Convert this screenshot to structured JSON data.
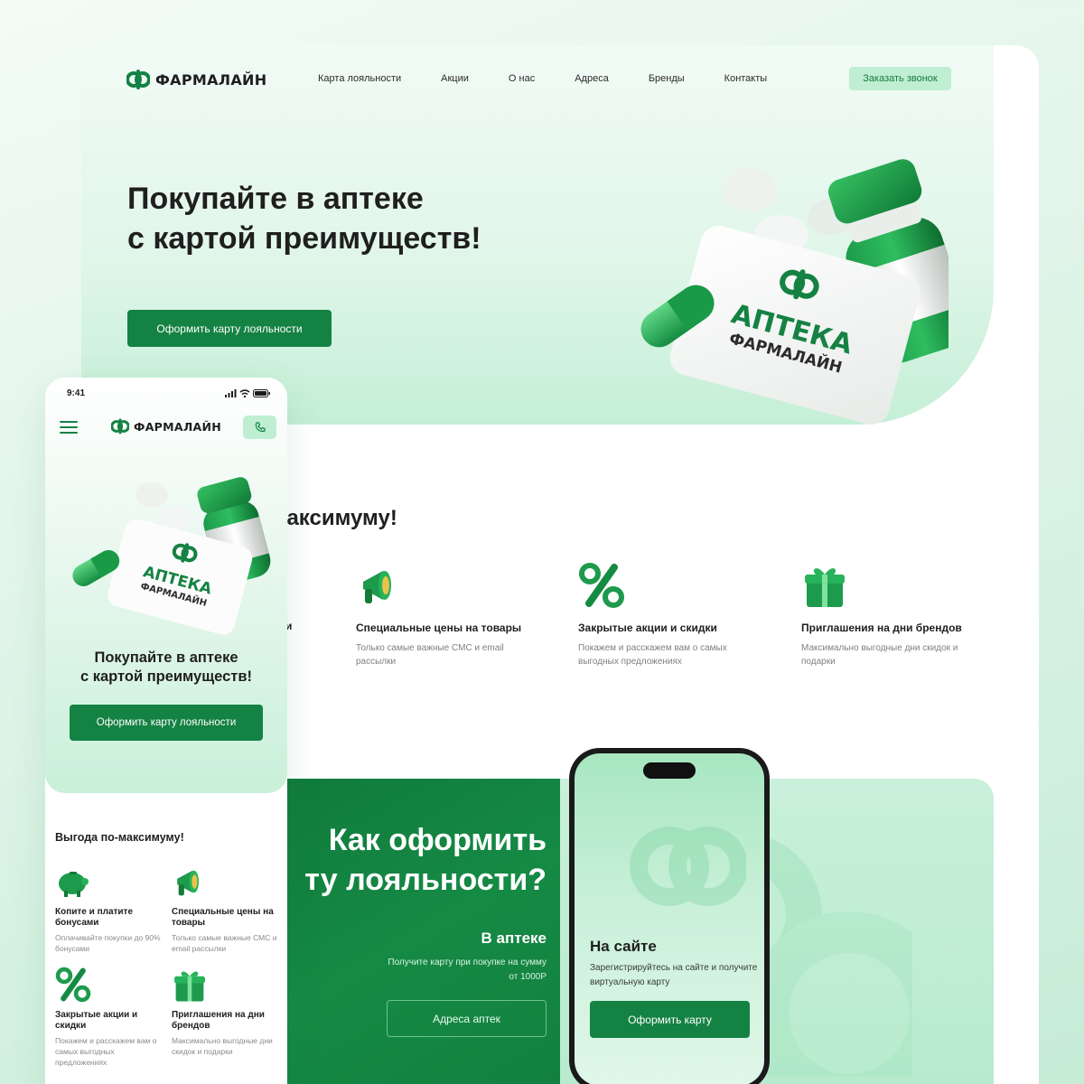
{
  "brand": {
    "name": "ФАРМАЛАЙН",
    "primary": "#148243",
    "accent_light": "#bfeed2"
  },
  "desktop": {
    "nav": [
      "Карта лояльности",
      "Акции",
      "О нас",
      "Адреса",
      "Бренды",
      "Контакты"
    ],
    "callback_label": "Заказать звонок",
    "hero": {
      "title_line1": "Покупайте в аптеке",
      "title_line2": "с картой преимуществ!",
      "button": "Оформить карту лояльности",
      "card_text_line1": "АПТЕКА",
      "card_text_line2": "ФАРМАЛАЙН"
    },
    "benefits": {
      "title": "максимуму!",
      "partial_label": "и",
      "items": [
        {
          "icon": "megaphone-icon",
          "title": "Специальные цены на товары",
          "desc": "Только самые важные СМС и email рассылки"
        },
        {
          "icon": "percent-icon",
          "title": "Закрытые акции и скидки",
          "desc": "Покажем и расскажем вам о самых выгодных предложениях"
        },
        {
          "icon": "gift-icon",
          "title": "Приглашения на дни брендов",
          "desc": "Максимально выгодные дни скидок и подарки"
        }
      ]
    },
    "how": {
      "title_line1": "Как оформить",
      "title_line2": "ту лояльности?",
      "shop": {
        "title": "В аптеке",
        "desc": "Получите карту при покупке на сумму от 1000Р",
        "button": "Адреса аптек"
      },
      "site": {
        "title": "На сайте",
        "desc": "Зарегистрируйтесь на сайте и получите виртуальную карту",
        "button": "Оформить карту"
      }
    }
  },
  "mobile": {
    "status_time": "9:41",
    "hero": {
      "title_line1": "Покупайте в аптеке",
      "title_line2": "с картой преимуществ!",
      "button": "Оформить карту лояльности"
    },
    "benefits": {
      "title": "Выгода по-максимуму!",
      "items": [
        {
          "icon": "piggy-bank-icon",
          "title": "Копите и платите бонусами",
          "desc": "Оплачивайте покупки до 90% бонусами"
        },
        {
          "icon": "megaphone-icon",
          "title": "Специальные цены на товары",
          "desc": "Только самые важные СМС и email рассылки"
        },
        {
          "icon": "percent-icon",
          "title": "Закрытые акции и скидки",
          "desc": "Покажем и расскажем вам о самых выгодных предложениях"
        },
        {
          "icon": "gift-icon",
          "title": "Приглашения на дни брендов",
          "desc": "Максимально выгодные дни скидок и подарки"
        }
      ]
    }
  }
}
